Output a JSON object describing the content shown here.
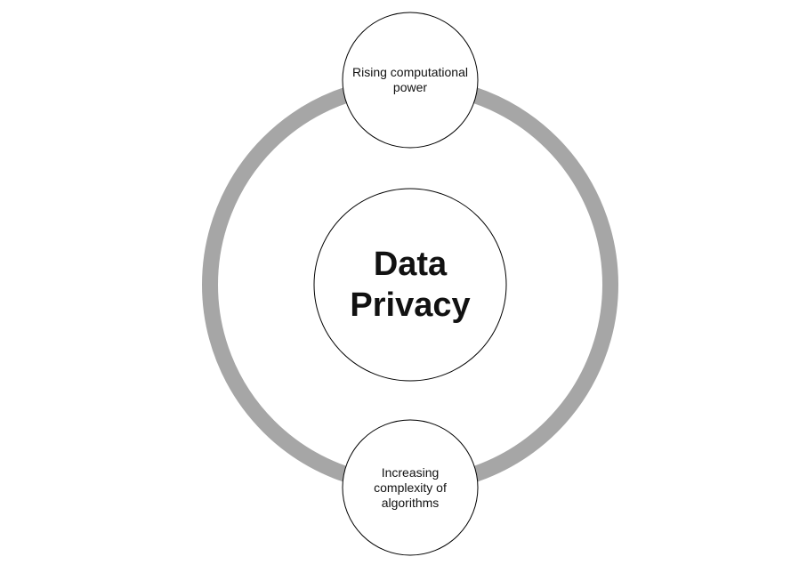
{
  "diagram": {
    "center": {
      "label": "Data Privacy"
    },
    "nodes": [
      {
        "label": "Rising computational power"
      },
      {
        "label": "Increasing complexity of algorithms"
      }
    ],
    "colors": {
      "ring": "#a6a6a6",
      "outline": "#000000",
      "fill": "#ffffff"
    }
  }
}
